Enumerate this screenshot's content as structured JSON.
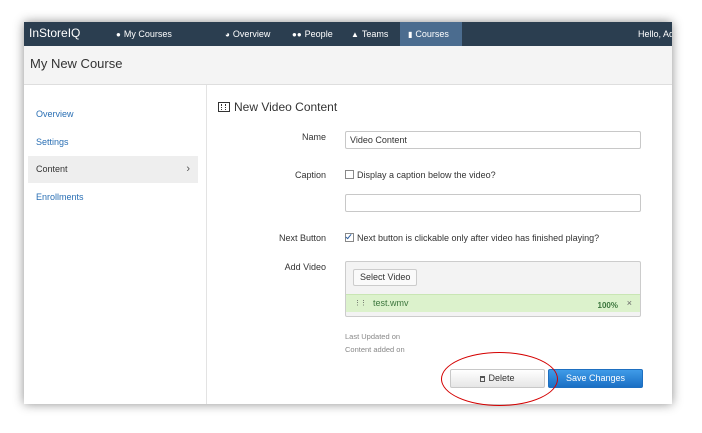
{
  "navbar": {
    "brand": "InStoreIQ",
    "items": [
      {
        "label": "My Courses",
        "icon": "user-icon"
      },
      {
        "label": "Overview",
        "icon": "dashboard-icon"
      },
      {
        "label": "People",
        "icon": "users-icon"
      },
      {
        "label": "Teams",
        "icon": "sitemap-icon"
      },
      {
        "label": "Courses",
        "icon": "book-icon",
        "active": true
      }
    ],
    "hello": "Hello, Ad"
  },
  "page": {
    "title": "My New Course"
  },
  "sidebar": {
    "items": [
      {
        "label": "Overview"
      },
      {
        "label": "Settings"
      },
      {
        "label": "Content",
        "active": true
      },
      {
        "label": "Enrollments"
      }
    ]
  },
  "form": {
    "heading": "New Video Content",
    "name_label": "Name",
    "name_value": "Video Content",
    "caption_label": "Caption",
    "caption_checkbox_label": "Display a caption below the video?",
    "caption_value": "",
    "next_label": "Next Button",
    "next_checkbox_label": "Next button is clickable only after video has finished playing?",
    "video_label": "Add Video",
    "select_video": "Select Video",
    "file_name": "test.wmv",
    "file_progress": "100%",
    "remove_glyph": "×",
    "last_updated": "Last Updated on",
    "content_added": "Content added on"
  },
  "actions": {
    "delete": "Delete",
    "save": "Save Changes"
  },
  "colors": {
    "navbar": "#2b3e50",
    "nav_active": "#4b6c8f",
    "link": "#2a6fb4",
    "save": "#1a6fc4",
    "progress_bg": "#dcf2cc",
    "annotation": "#d40000"
  }
}
